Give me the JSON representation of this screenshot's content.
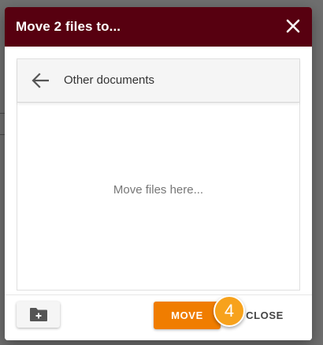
{
  "dialog": {
    "title": "Move 2 files to...",
    "close_icon": "close-icon"
  },
  "navigator": {
    "back_icon": "arrow-left-icon",
    "current_folder": "Other documents",
    "empty_message": "Move files here..."
  },
  "footer": {
    "new_folder_icon": "create-new-folder-icon",
    "move_label": "MOVE",
    "close_label": "CLOSE"
  },
  "annotation": {
    "step_number": "4"
  },
  "colors": {
    "header_bg": "#570010",
    "move_button": "#f07d00",
    "badge": "#f7a21c",
    "overlay": "#6f6f6f"
  }
}
